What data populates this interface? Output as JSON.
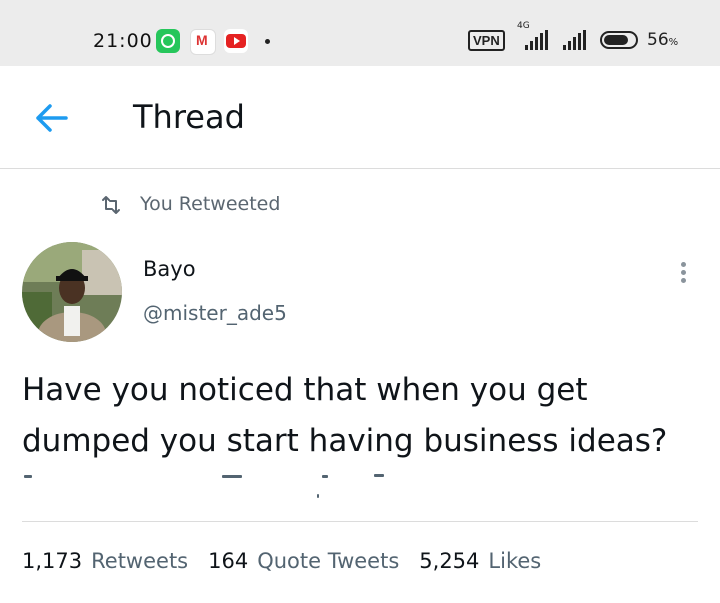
{
  "status_bar": {
    "time": "21:00",
    "gmail_glyph": "M",
    "vpn": "VPN",
    "network": "4G",
    "battery": "56",
    "battery_unit": "%",
    "icons": [
      "whatsapp-icon",
      "gmail-icon",
      "youtube-icon",
      "notification-dot",
      "signal-icon",
      "battery-icon"
    ]
  },
  "header": {
    "title": "Thread",
    "back_icon": "arrow-left-icon"
  },
  "retweet_context": {
    "label": "You Retweeted",
    "icon": "retweet-icon"
  },
  "tweet": {
    "author_name": "Bayo",
    "author_handle": "@mister_ade5",
    "text": "Have you noticed that when you get dumped you start having business ideas?",
    "more_icon": "more-vertical-icon"
  },
  "stats": [
    {
      "count": "1,173",
      "label": "Retweets"
    },
    {
      "count": "164",
      "label": "Quote Tweets"
    },
    {
      "count": "5,254",
      "label": "Likes"
    }
  ],
  "colors": {
    "accent": "#1d9bf0",
    "text_primary": "#0f1419",
    "text_secondary": "#536471",
    "status_bar_bg": "#ececec"
  }
}
